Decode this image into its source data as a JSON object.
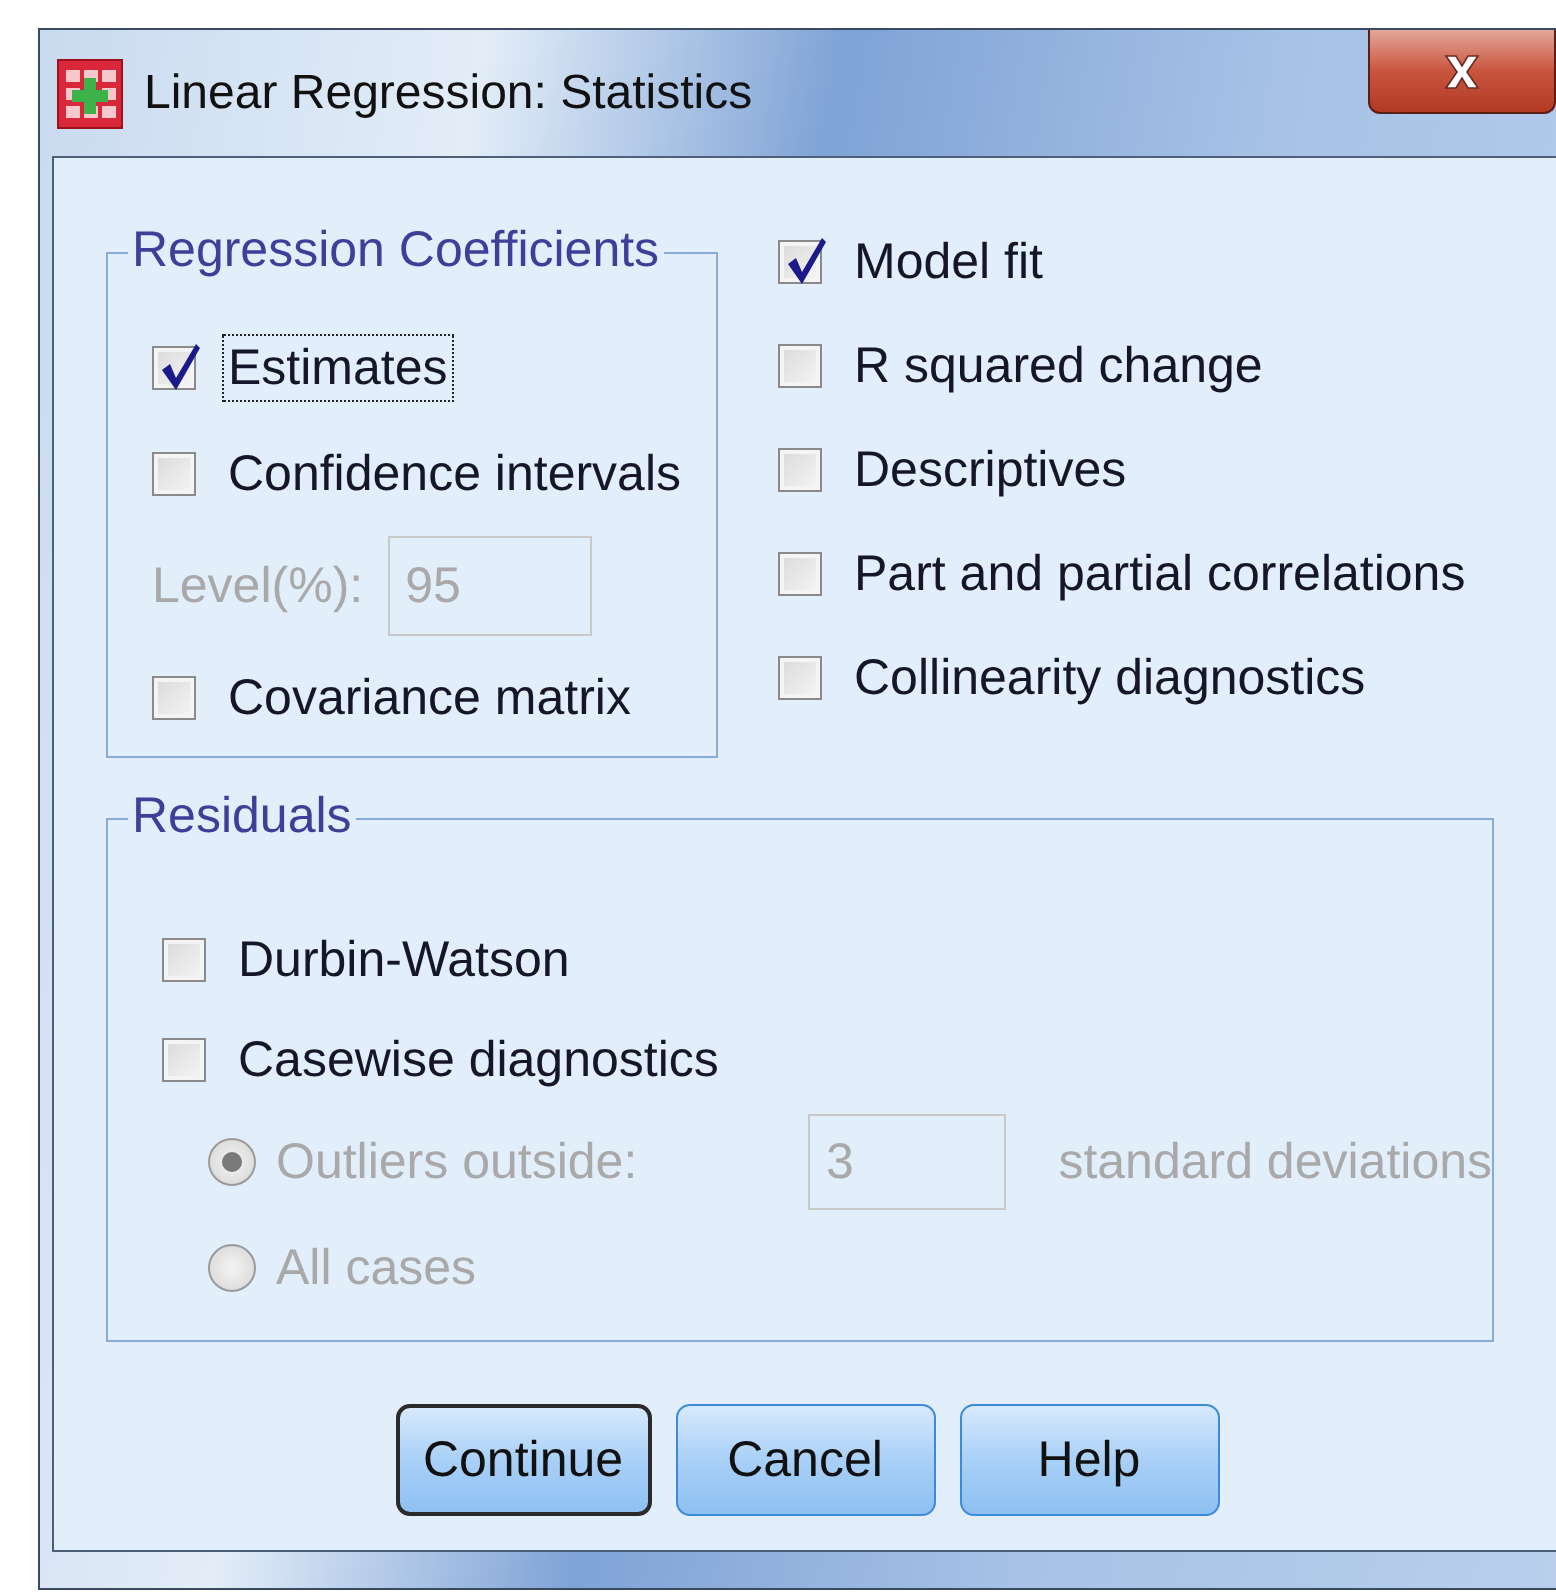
{
  "window": {
    "title": "Linear Regression: Statistics"
  },
  "regression_coefficients": {
    "title": "Regression Coefficients",
    "items": [
      {
        "kind": "checkbox",
        "label": "Estimates",
        "checked": true,
        "focused": true
      },
      {
        "kind": "checkbox",
        "label": "Confidence intervals",
        "checked": false,
        "focused": false
      },
      {
        "kind": "field",
        "label": "Level(%):",
        "value": "95",
        "disabled": true
      },
      {
        "kind": "checkbox",
        "label": "Covariance matrix",
        "checked": false,
        "focused": false
      }
    ]
  },
  "options": [
    {
      "kind": "checkbox",
      "label": "Model fit",
      "checked": true,
      "focused": false
    },
    {
      "kind": "checkbox",
      "label": "R squared change",
      "checked": false,
      "focused": false
    },
    {
      "kind": "checkbox",
      "label": "Descriptives",
      "checked": false,
      "focused": false
    },
    {
      "kind": "checkbox",
      "label": "Part and partial correlations",
      "checked": false,
      "focused": false
    },
    {
      "kind": "checkbox",
      "label": "Collinearity diagnostics",
      "checked": false,
      "focused": false
    }
  ],
  "residuals": {
    "title": "Residuals",
    "items": [
      {
        "kind": "checkbox",
        "label": "Durbin-Watson",
        "checked": false,
        "focused": false
      },
      {
        "kind": "checkbox",
        "label": "Casewise diagnostics",
        "checked": false,
        "focused": false
      },
      {
        "kind": "radio",
        "label": "Outliers outside:",
        "selected": true,
        "disabled": true,
        "value": "3",
        "suffix": "standard deviations"
      },
      {
        "kind": "radio",
        "label": "All cases",
        "selected": false,
        "disabled": true
      }
    ]
  },
  "buttons": [
    {
      "label": "Continue",
      "default": true
    },
    {
      "label": "Cancel",
      "default": false
    },
    {
      "label": "Help",
      "default": false
    }
  ]
}
